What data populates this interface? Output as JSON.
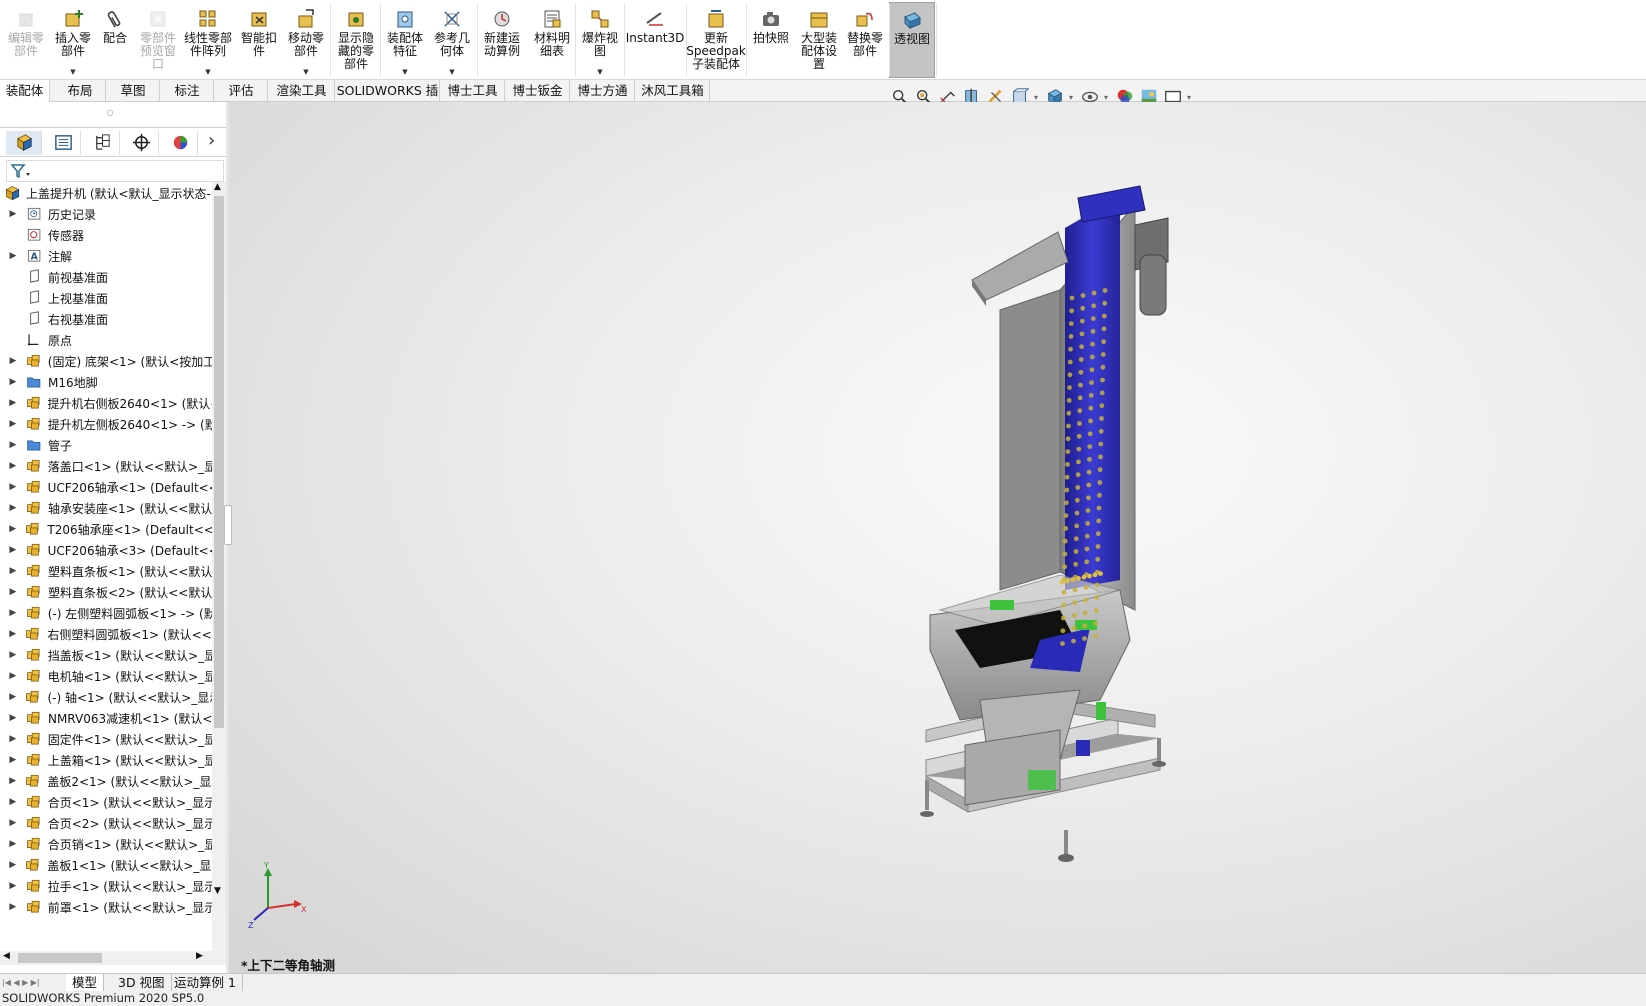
{
  "ribbon": {
    "buttons": [
      {
        "label": "编辑零\n部件",
        "icon": "edit-component-icon",
        "disabled": true
      },
      {
        "label": "插入零\n部件",
        "icon": "insert-component-icon",
        "dropdown": true
      },
      {
        "label": "配合",
        "icon": "mate-paperclip-icon"
      },
      {
        "label": "零部件\n预览窗\n口",
        "icon": "component-preview-icon",
        "disabled": true
      },
      {
        "label": "线性零部\n件阵列",
        "icon": "linear-pattern-icon",
        "dropdown": true
      },
      {
        "label": "智能扣\n件",
        "icon": "smart-fasteners-icon"
      },
      {
        "label": "移动零\n部件",
        "icon": "move-component-icon",
        "dropdown": true
      },
      {
        "label": "显示隐\n藏的零\n部件",
        "icon": "show-hidden-icon"
      },
      {
        "label": "装配体\n特征",
        "icon": "assembly-features-icon",
        "dropdown": true
      },
      {
        "label": "参考几\n何体",
        "icon": "reference-geometry-icon",
        "dropdown": true
      },
      {
        "label": "新建运\n动算例",
        "icon": "motion-study-icon"
      },
      {
        "label": "材料明\n细表",
        "icon": "bom-icon"
      },
      {
        "label": "爆炸视\n图",
        "icon": "exploded-view-icon",
        "dropdown": true
      },
      {
        "label": "Instant3D",
        "icon": "instant3d-icon"
      },
      {
        "label": "更新\nSpeedpak\n子装配体",
        "icon": "speedpak-icon"
      },
      {
        "label": "拍快照",
        "icon": "camera-icon"
      },
      {
        "label": "大型装\n配体设\n置",
        "icon": "large-assembly-icon"
      },
      {
        "label": "替换零\n部件",
        "icon": "replace-component-icon"
      },
      {
        "label": "透视图",
        "icon": "perspective-icon",
        "active": true
      }
    ]
  },
  "command_tabs": [
    "装配体",
    "布局",
    "草图",
    "标注",
    "评估",
    "渲染工具",
    "SOLIDWORKS 插件",
    "博士工具",
    "博士钣金",
    "博士方通",
    "沐风工具箱"
  ],
  "view_toolbar": [
    "zoom-to-fit-icon",
    "zoom-area-icon",
    "previous-view-icon",
    "section-view-icon",
    "dynamic-annotation-icon",
    "view-orientation-icon",
    "display-style-icon",
    "hide-show-items-icon",
    "edit-appearance-icon",
    "scene-icon",
    "view-settings-icon"
  ],
  "feature_manager": {
    "tabs": [
      "featuremanager-tab-icon",
      "propertymanager-tab-icon",
      "configurationmanager-tab-icon",
      "dimxpert-tab-icon",
      "displaymanager-tab-icon"
    ],
    "root": "上盖提升机 (默认<默认_显示状态-",
    "items": [
      {
        "label": "历史记录",
        "icon": "history-icon",
        "expand": true
      },
      {
        "label": "传感器",
        "icon": "sensor-icon",
        "expand": false
      },
      {
        "label": "注解",
        "icon": "annotation-icon",
        "expand": true
      },
      {
        "label": "前视基准面",
        "icon": "plane-icon",
        "expand": false
      },
      {
        "label": "上视基准面",
        "icon": "plane-icon",
        "expand": false
      },
      {
        "label": "右视基准面",
        "icon": "plane-icon",
        "expand": false
      },
      {
        "label": "原点",
        "icon": "origin-icon",
        "expand": false
      },
      {
        "label": "(固定) 底架<1> (默认<按加工",
        "icon": "subassembly-icon",
        "expand": true
      },
      {
        "label": "M16地脚",
        "icon": "folder-icon",
        "expand": true
      },
      {
        "label": "提升机右侧板2640<1> (默认<",
        "icon": "subassembly-icon",
        "expand": true
      },
      {
        "label": "提升机左侧板2640<1> -> (默",
        "icon": "subassembly-icon",
        "expand": true
      },
      {
        "label": "管子",
        "icon": "folder-icon",
        "expand": true
      },
      {
        "label": "落盖口<1> (默认<<默认>_显",
        "icon": "subassembly-icon",
        "expand": true
      },
      {
        "label": "UCF206轴承<1> (Default<<",
        "icon": "subassembly-icon",
        "expand": true
      },
      {
        "label": "轴承安装座<1> (默认<<默认",
        "icon": "subassembly-icon",
        "expand": true
      },
      {
        "label": "T206轴承座<1> (Default<<D",
        "icon": "subassembly-icon",
        "expand": true
      },
      {
        "label": "UCF206轴承<3> (Default<<",
        "icon": "subassembly-icon",
        "expand": true
      },
      {
        "label": "塑料直条板<1> (默认<<默认",
        "icon": "subassembly-icon",
        "expand": true
      },
      {
        "label": "塑料直条板<2> (默认<<默认",
        "icon": "subassembly-icon",
        "expand": true
      },
      {
        "label": "(-) 左侧塑料圆弧板<1> -> (默",
        "icon": "subassembly-icon",
        "expand": true
      },
      {
        "label": "右侧塑料圆弧板<1> (默认<<默",
        "icon": "subassembly-icon",
        "expand": true
      },
      {
        "label": "挡盖板<1> (默认<<默认>_显",
        "icon": "subassembly-icon",
        "expand": true
      },
      {
        "label": "电机轴<1> (默认<<默认>_显",
        "icon": "subassembly-icon",
        "expand": true
      },
      {
        "label": "(-) 轴<1> (默认<<默认>_显示",
        "icon": "subassembly-icon",
        "expand": true
      },
      {
        "label": "NMRV063减速机<1> (默认<",
        "icon": "subassembly-icon",
        "expand": true
      },
      {
        "label": "固定件<1> (默认<<默认>_显",
        "icon": "subassembly-icon",
        "expand": true
      },
      {
        "label": "上盖箱<1> (默认<<默认>_显",
        "icon": "subassembly-icon",
        "expand": true
      },
      {
        "label": "盖板2<1> (默认<<默认>_显示",
        "icon": "subassembly-icon",
        "expand": true
      },
      {
        "label": "合页<1> (默认<<默认>_显示",
        "icon": "subassembly-icon",
        "expand": true
      },
      {
        "label": "合页<2> (默认<<默认>_显示",
        "icon": "subassembly-icon",
        "expand": true
      },
      {
        "label": "合页销<1> (默认<<默认>_显",
        "icon": "subassembly-icon",
        "expand": true
      },
      {
        "label": "盖板1<1> (默认<<默认>_显示",
        "icon": "subassembly-icon",
        "expand": true
      },
      {
        "label": "拉手<1> (默认<<默认>_显示",
        "icon": "subassembly-icon",
        "expand": true
      },
      {
        "label": "前罩<1> (默认<<默认>_显示",
        "icon": "subassembly-icon",
        "expand": true
      }
    ]
  },
  "viewport": {
    "view_name": "*上下二等角轴测",
    "triad": {
      "x": "X",
      "y": "Y",
      "z": "Z"
    }
  },
  "bottom_tabs": [
    "模型",
    "3D 视图",
    "运动算例 1"
  ],
  "status": "SOLIDWORKS Premium 2020 SP5.0",
  "colors": {
    "active_tab": "#ffffff",
    "ribbon_active": "#c4c4c4",
    "belt_blue": "#2a2ab8",
    "steel": "#9a9a9a",
    "green_parts": "#3ec23e"
  }
}
